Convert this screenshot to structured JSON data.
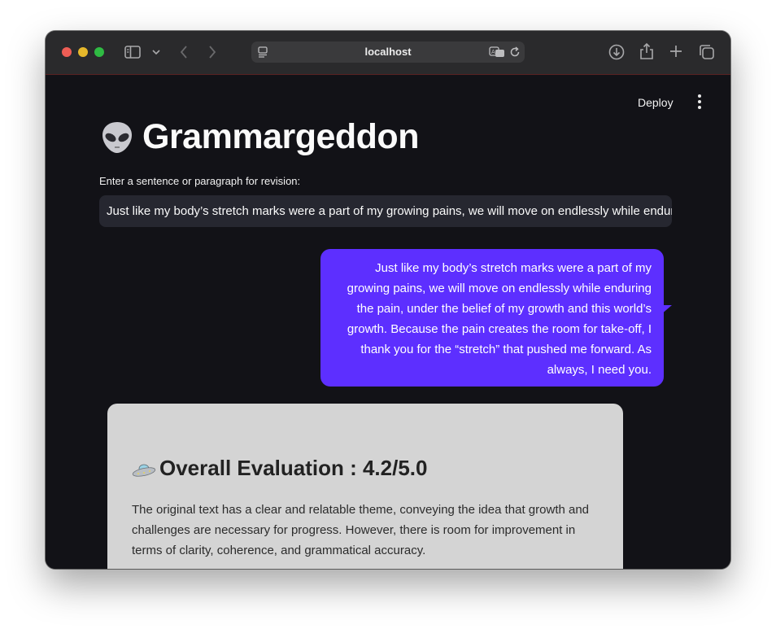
{
  "browser": {
    "url": "localhost"
  },
  "header": {
    "deploy_label": "Deploy"
  },
  "app": {
    "title": "Grammargeddon",
    "input_label": "Enter a sentence or paragraph for revision:",
    "input_value": "Just like my body’s stretch marks were a part of my growing pains, we will move on endlessly while enduring the pain, under the belief of my growth and this world’s growth. Because the pain creates the room for take-off, I thank you for the “stretch” that pushed me forward. As always, I need you."
  },
  "chat": {
    "user_message": "Just like my body’s stretch marks were a part of my growing pains, we will move on endlessly while enduring the pain, under the belief of my growth and this world’s growth. Because the pain creates the room for take-off, I thank you for the “stretch” that pushed me forward. As always, I need you."
  },
  "evaluation": {
    "heading": "Overall Evaluation : 4.2/5.0",
    "body": "The original text has a clear and relatable theme, conveying the idea that growth and challenges are necessary for progress. However, there is room for improvement in terms of clarity, coherence, and grammatical accuracy."
  },
  "colors": {
    "accent": "#5d2fff",
    "background": "#121217",
    "card": "#d4d4d4"
  },
  "icons": [
    "sidebar-icon",
    "chevron-down-icon",
    "back-icon",
    "forward-icon",
    "page-icon",
    "translate-icon",
    "reload-icon",
    "download-icon",
    "share-icon",
    "plus-icon",
    "tabs-icon",
    "kebab-menu-icon",
    "alien-icon",
    "ufo-icon"
  ]
}
